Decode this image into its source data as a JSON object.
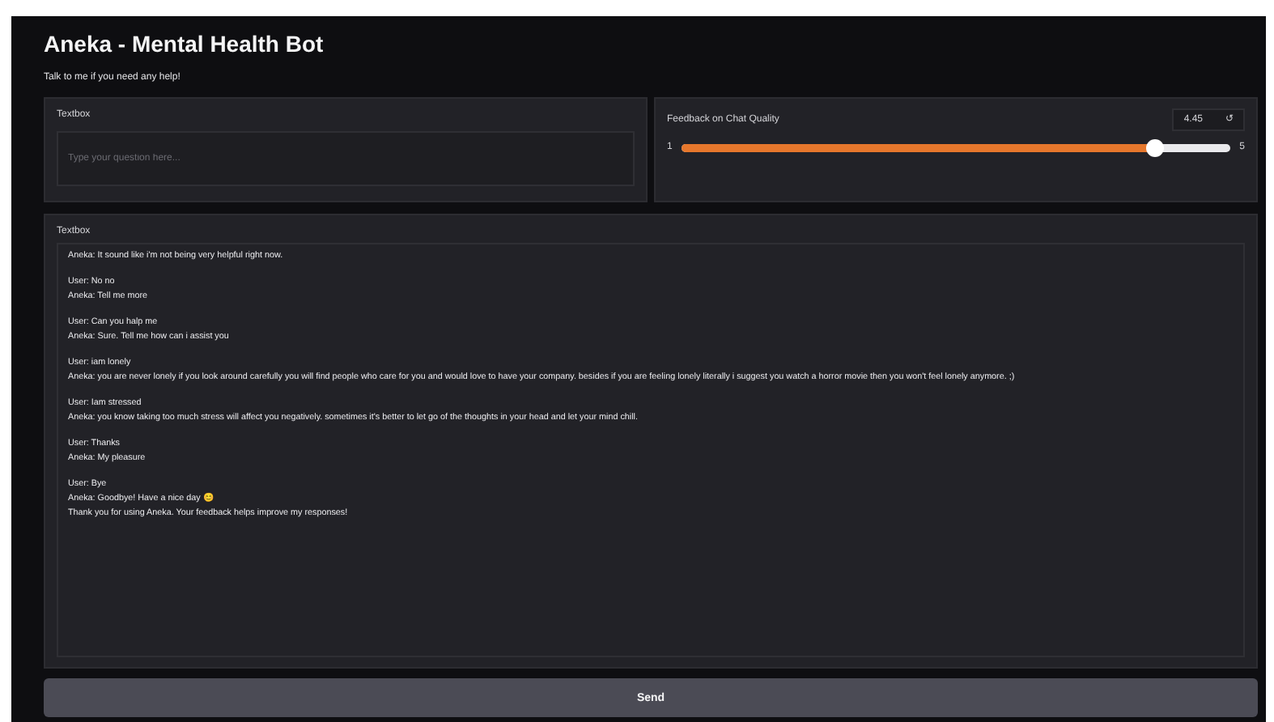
{
  "title": "Aneka - Mental Health Bot",
  "subtitle": "Talk to me if you need any help!",
  "input": {
    "label": "Textbox",
    "placeholder": "Type your question here..."
  },
  "feedback": {
    "label": "Feedback on Chat Quality",
    "value": "4.45",
    "min": "1",
    "max": "5",
    "level": 0.8625,
    "reset_icon": "↺"
  },
  "chat": {
    "label": "Textbox",
    "groups": [
      [
        "Aneka: It sound like i'm not being very helpful right now."
      ],
      [
        "User: No no",
        "Aneka: Tell me more"
      ],
      [
        "User: Can you halp me",
        "Aneka: Sure. Tell me how can i assist you"
      ],
      [
        "User: iam lonely",
        "Aneka: you are never lonely if you look around carefully you will find people who care for you and would love to have your company. besides if you are feeling lonely literally i suggest you watch a horror movie then you won't feel lonely anymore. ;)"
      ],
      [
        "User: Iam stressed",
        "Aneka: you know taking too much stress will affect you negatively. sometimes it's better to let go of the thoughts in your head and let your mind chill."
      ],
      [
        "User: Thanks",
        "Aneka: My pleasure"
      ],
      [
        "User: Bye",
        "Aneka: Goodbye! Have a nice day 😊",
        "Thank you for using Aneka. Your feedback helps improve my responses!"
      ]
    ]
  },
  "send_button": "Send"
}
